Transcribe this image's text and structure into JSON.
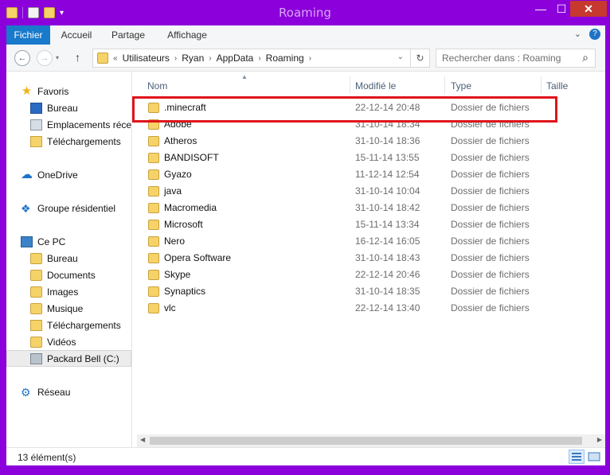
{
  "window": {
    "title": "Roaming",
    "minimize_glyph": "—",
    "maximize_glyph": "☐",
    "close_glyph": "✕"
  },
  "ribbon": {
    "tabs": [
      {
        "label": "Fichier"
      },
      {
        "label": "Accueil"
      },
      {
        "label": "Partage"
      },
      {
        "label": "Affichage"
      }
    ],
    "expand_glyph": "⌄",
    "help_glyph": "?"
  },
  "nav_buttons": {
    "back": "←",
    "forward": "→",
    "up": "↑"
  },
  "address": {
    "prefix": "«",
    "segments": [
      "Utilisateurs",
      "Ryan",
      "AppData",
      "Roaming"
    ],
    "refresh": "↻",
    "dropdown": "⌄"
  },
  "search": {
    "placeholder": "Rechercher dans : Roaming",
    "icon": "⌕"
  },
  "sidebar": {
    "favorites": {
      "label": "Favoris",
      "items": [
        {
          "label": "Bureau",
          "icon": "desktop-icon"
        },
        {
          "label": "Emplacements récents",
          "icon": "recent-places-icon"
        },
        {
          "label": "Téléchargements",
          "icon": "downloads-icon"
        }
      ]
    },
    "onedrive": {
      "label": "OneDrive"
    },
    "homegroup": {
      "label": "Groupe résidentiel"
    },
    "this_pc": {
      "label": "Ce PC",
      "items": [
        {
          "label": "Bureau"
        },
        {
          "label": "Documents"
        },
        {
          "label": "Images"
        },
        {
          "label": "Musique"
        },
        {
          "label": "Téléchargements"
        },
        {
          "label": "Vidéos"
        },
        {
          "label": "Packard Bell (C:)"
        }
      ]
    },
    "network": {
      "label": "Réseau"
    }
  },
  "columns": {
    "name": "Nom",
    "modified": "Modifié le",
    "type": "Type",
    "size": "Taille"
  },
  "files": [
    {
      "name": ".minecraft",
      "date": "22-12-14 20:48",
      "type": "Dossier de fichiers"
    },
    {
      "name": "Adobe",
      "date": "31-10-14 18:34",
      "type": "Dossier de fichiers"
    },
    {
      "name": "Atheros",
      "date": "31-10-14 18:36",
      "type": "Dossier de fichiers"
    },
    {
      "name": "BANDISOFT",
      "date": "15-11-14 13:55",
      "type": "Dossier de fichiers"
    },
    {
      "name": "Gyazo",
      "date": "11-12-14 12:54",
      "type": "Dossier de fichiers"
    },
    {
      "name": "java",
      "date": "31-10-14 10:04",
      "type": "Dossier de fichiers"
    },
    {
      "name": "Macromedia",
      "date": "31-10-14 18:42",
      "type": "Dossier de fichiers"
    },
    {
      "name": "Microsoft",
      "date": "15-11-14 13:34",
      "type": "Dossier de fichiers"
    },
    {
      "name": "Nero",
      "date": "16-12-14 16:05",
      "type": "Dossier de fichiers"
    },
    {
      "name": "Opera Software",
      "date": "31-10-14 18:43",
      "type": "Dossier de fichiers"
    },
    {
      "name": "Skype",
      "date": "22-12-14 20:46",
      "type": "Dossier de fichiers"
    },
    {
      "name": "Synaptics",
      "date": "31-10-14 18:35",
      "type": "Dossier de fichiers"
    },
    {
      "name": "vlc",
      "date": "22-12-14 13:40",
      "type": "Dossier de fichiers"
    }
  ],
  "status": {
    "count": "13 élément(s)"
  },
  "colors": {
    "window_frame": "#8b00db",
    "file_tab": "#1979ca",
    "highlight_box": "#e0141b"
  }
}
